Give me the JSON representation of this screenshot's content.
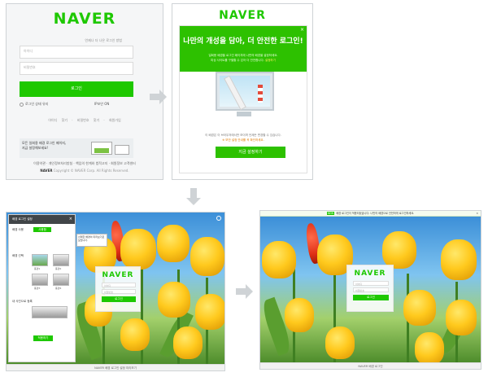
{
  "colors": {
    "brand": "#1ec800",
    "popup_green": "#2dc100",
    "panel_border": "#cfd3d6"
  },
  "login_page": {
    "logo": "NAVER",
    "helper_link": "언제나 더 나은 로그인 방법",
    "id_placeholder": "아이디",
    "pw_placeholder": "비밀번호",
    "login_button": "로그인",
    "keep_login": "로그인 상태 유지",
    "ip_security": "IP보안 ON",
    "links": "아이디 찾기 · 비밀번호 찾기 · 회원가입",
    "banner_line1": "모든 일회용 배경 로그인 페이지,",
    "banner_highlight": "일회용 배경",
    "banner_line2": "지금 설정해보세요!",
    "footer_links": "이용약관 · 개인정보처리방침 · 책임의 한계와 법적고지 · 회원정보 고객센터",
    "footer_brand": "NAVER",
    "footer_copy": "Copyright © NAVER Corp. All Rights Reserved."
  },
  "popup": {
    "logo": "NAVER",
    "close": "×",
    "headline": "나만의 개성을 담아, 더 안전한 로그인!",
    "sub1": "일회용 배경을 로그인 페이지에 나만의 배경을 설정하세요.",
    "sub2": "피싱 사이트를 구별할 수 있어 더 안전합니다.",
    "sub2_link": "설정하기",
    "note1": "이 배경은 이 브라우저에서만 보이며 언제든 변경할 수 있습니다.",
    "note2": "※ 보안 설정 안내를 꼭 확인하세요.",
    "cta": "지금 설정하기"
  },
  "settings_screen": {
    "panel_title": "배경 로그인 설정",
    "panel_close": "×",
    "section1": "배경 사용",
    "on_button": "사용함",
    "section2": "배경 선택",
    "thumb_labels": [
      "풍경1",
      "풍경2",
      "풍경3",
      "풍경4"
    ],
    "section3": "내 사진으로 등록",
    "apply_button": "적용하기",
    "tooltip": "선택한 배경이 미리보기로 보입니다.",
    "card_logo": "NAVER",
    "card_id": "아이디",
    "card_pw": "비밀번호",
    "card_button": "로그인",
    "statusbar": "NAVER 배경 로그인 설정 미리보기"
  },
  "final_screen": {
    "topbar_tag": "NEW",
    "topbar_text": "배경 로그인이 적용되었습니다. 나만의 배경으로 안전하게 로그인하세요.",
    "topbar_close": "×",
    "card_logo": "NAVER",
    "card_id": "아이디",
    "card_pw": "비밀번호",
    "card_button": "로그인",
    "statusbar": "NAVER 배경 로그인"
  }
}
